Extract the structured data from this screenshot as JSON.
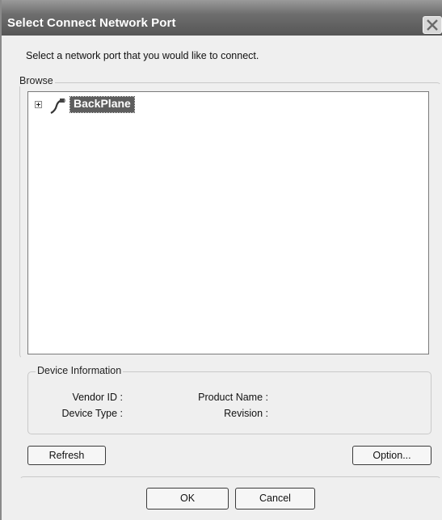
{
  "window": {
    "title": "Select Connect Network Port"
  },
  "instruction": "Select a network port that you would like to connect.",
  "browse": {
    "label": "Browse",
    "tree": [
      {
        "label": "BackPlane",
        "expanded": false,
        "selected": true,
        "icon": "network-cable-icon"
      }
    ]
  },
  "device_info": {
    "label": "Device Information",
    "vendor_id_label": "Vendor ID :",
    "device_type_label": "Device Type :",
    "product_name_label": "Product Name :",
    "revision_label": "Revision :"
  },
  "buttons": {
    "refresh": "Refresh",
    "option": "Option...",
    "ok": "OK",
    "cancel": "Cancel"
  }
}
